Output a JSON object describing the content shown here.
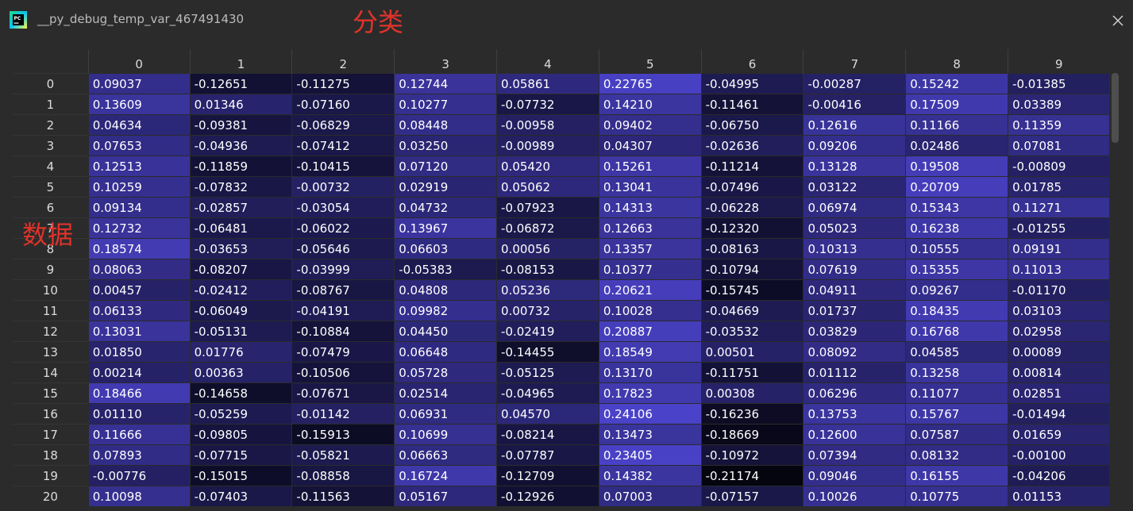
{
  "window": {
    "title": "__py_debug_temp_var_467491430",
    "app_icon": "pycharm-icon",
    "close_icon": "close-icon"
  },
  "annotations": {
    "top": "分类",
    "left": "数据"
  },
  "table": {
    "columns": [
      "0",
      "1",
      "2",
      "3",
      "4",
      "5",
      "6",
      "7",
      "8",
      "9"
    ],
    "rows": [
      {
        "index": "0",
        "values": [
          "0.09037",
          "-0.12651",
          "-0.11275",
          "0.12744",
          "0.05861",
          "0.22765",
          "-0.04995",
          "-0.00287",
          "0.15242",
          "-0.01385"
        ]
      },
      {
        "index": "1",
        "values": [
          "0.13609",
          "0.01346",
          "-0.07160",
          "0.10277",
          "-0.07732",
          "0.14210",
          "-0.11461",
          "-0.00416",
          "0.17509",
          "0.03389"
        ]
      },
      {
        "index": "2",
        "values": [
          "0.04634",
          "-0.09381",
          "-0.06829",
          "0.08448",
          "-0.00958",
          "0.09402",
          "-0.06750",
          "0.12616",
          "0.11166",
          "0.11359"
        ]
      },
      {
        "index": "3",
        "values": [
          "0.07653",
          "-0.04936",
          "-0.07412",
          "0.03250",
          "-0.00989",
          "0.04307",
          "-0.02636",
          "0.09206",
          "0.02486",
          "0.07081"
        ]
      },
      {
        "index": "4",
        "values": [
          "0.12513",
          "-0.11859",
          "-0.10415",
          "0.07120",
          "0.05420",
          "0.15261",
          "-0.11214",
          "0.13128",
          "0.19508",
          "-0.00809"
        ]
      },
      {
        "index": "5",
        "values": [
          "0.10259",
          "-0.07832",
          "-0.00732",
          "0.02919",
          "0.05062",
          "0.13041",
          "-0.07496",
          "0.03122",
          "0.20709",
          "0.01785"
        ]
      },
      {
        "index": "6",
        "values": [
          "0.09134",
          "-0.02857",
          "-0.03054",
          "0.04732",
          "-0.07923",
          "0.14313",
          "-0.06228",
          "0.06974",
          "0.15343",
          "0.11271"
        ]
      },
      {
        "index": "7",
        "values": [
          "0.12732",
          "-0.06481",
          "-0.06022",
          "0.13967",
          "-0.06872",
          "0.12663",
          "-0.12320",
          "0.05023",
          "0.16238",
          "-0.01255"
        ]
      },
      {
        "index": "8",
        "values": [
          "0.18574",
          "-0.03653",
          "-0.05646",
          "0.06603",
          "0.00056",
          "0.13357",
          "-0.08163",
          "0.10313",
          "0.10555",
          "0.09191"
        ]
      },
      {
        "index": "9",
        "values": [
          "0.08063",
          "-0.08207",
          "-0.03999",
          "-0.05383",
          "-0.08153",
          "0.10377",
          "-0.10794",
          "0.07619",
          "0.15355",
          "0.11013"
        ]
      },
      {
        "index": "10",
        "values": [
          "0.00457",
          "-0.02412",
          "-0.08767",
          "0.04808",
          "0.05236",
          "0.20621",
          "-0.15745",
          "0.04911",
          "0.09267",
          "-0.01170"
        ]
      },
      {
        "index": "11",
        "values": [
          "0.06133",
          "-0.06049",
          "-0.04191",
          "0.09982",
          "0.00732",
          "0.10028",
          "-0.04669",
          "0.01737",
          "0.18435",
          "0.03103"
        ]
      },
      {
        "index": "12",
        "values": [
          "0.13031",
          "-0.05131",
          "-0.10884",
          "0.04450",
          "-0.02419",
          "0.20887",
          "-0.03532",
          "0.03829",
          "0.16768",
          "0.02958"
        ]
      },
      {
        "index": "13",
        "values": [
          "0.01850",
          "0.01776",
          "-0.07479",
          "0.06648",
          "-0.14455",
          "0.18549",
          "0.00501",
          "0.08092",
          "0.04585",
          "0.00089"
        ]
      },
      {
        "index": "14",
        "values": [
          "0.00214",
          "0.00363",
          "-0.10506",
          "0.05728",
          "-0.05125",
          "0.13170",
          "-0.11751",
          "0.01112",
          "0.13258",
          "0.00814"
        ]
      },
      {
        "index": "15",
        "values": [
          "0.18466",
          "-0.14658",
          "-0.07671",
          "0.02514",
          "-0.04965",
          "0.17823",
          "0.00308",
          "0.06296",
          "0.11077",
          "0.02851"
        ]
      },
      {
        "index": "16",
        "values": [
          "0.01110",
          "-0.05259",
          "-0.01142",
          "0.06931",
          "0.04570",
          "0.24106",
          "-0.16236",
          "0.13753",
          "0.15767",
          "-0.01494"
        ]
      },
      {
        "index": "17",
        "values": [
          "0.11666",
          "-0.09805",
          "-0.15913",
          "0.10699",
          "-0.08214",
          "0.13473",
          "-0.18669",
          "0.12600",
          "0.07587",
          "0.01659"
        ]
      },
      {
        "index": "18",
        "values": [
          "0.07893",
          "-0.07715",
          "-0.05821",
          "0.06663",
          "-0.07787",
          "0.23405",
          "-0.10972",
          "0.07394",
          "0.08132",
          "-0.00100"
        ]
      },
      {
        "index": "19",
        "values": [
          "-0.00776",
          "-0.15015",
          "-0.08858",
          "0.16724",
          "-0.12709",
          "0.14382",
          "-0.21174",
          "0.09046",
          "0.16155",
          "-0.04206"
        ]
      },
      {
        "index": "20",
        "values": [
          "0.10098",
          "-0.07403",
          "-0.11563",
          "0.05167",
          "-0.12926",
          "0.07003",
          "-0.07157",
          "0.10026",
          "0.10775",
          "0.01153"
        ]
      }
    ],
    "color_scale": {
      "low": "#050510",
      "high": "#4a42c8"
    }
  }
}
